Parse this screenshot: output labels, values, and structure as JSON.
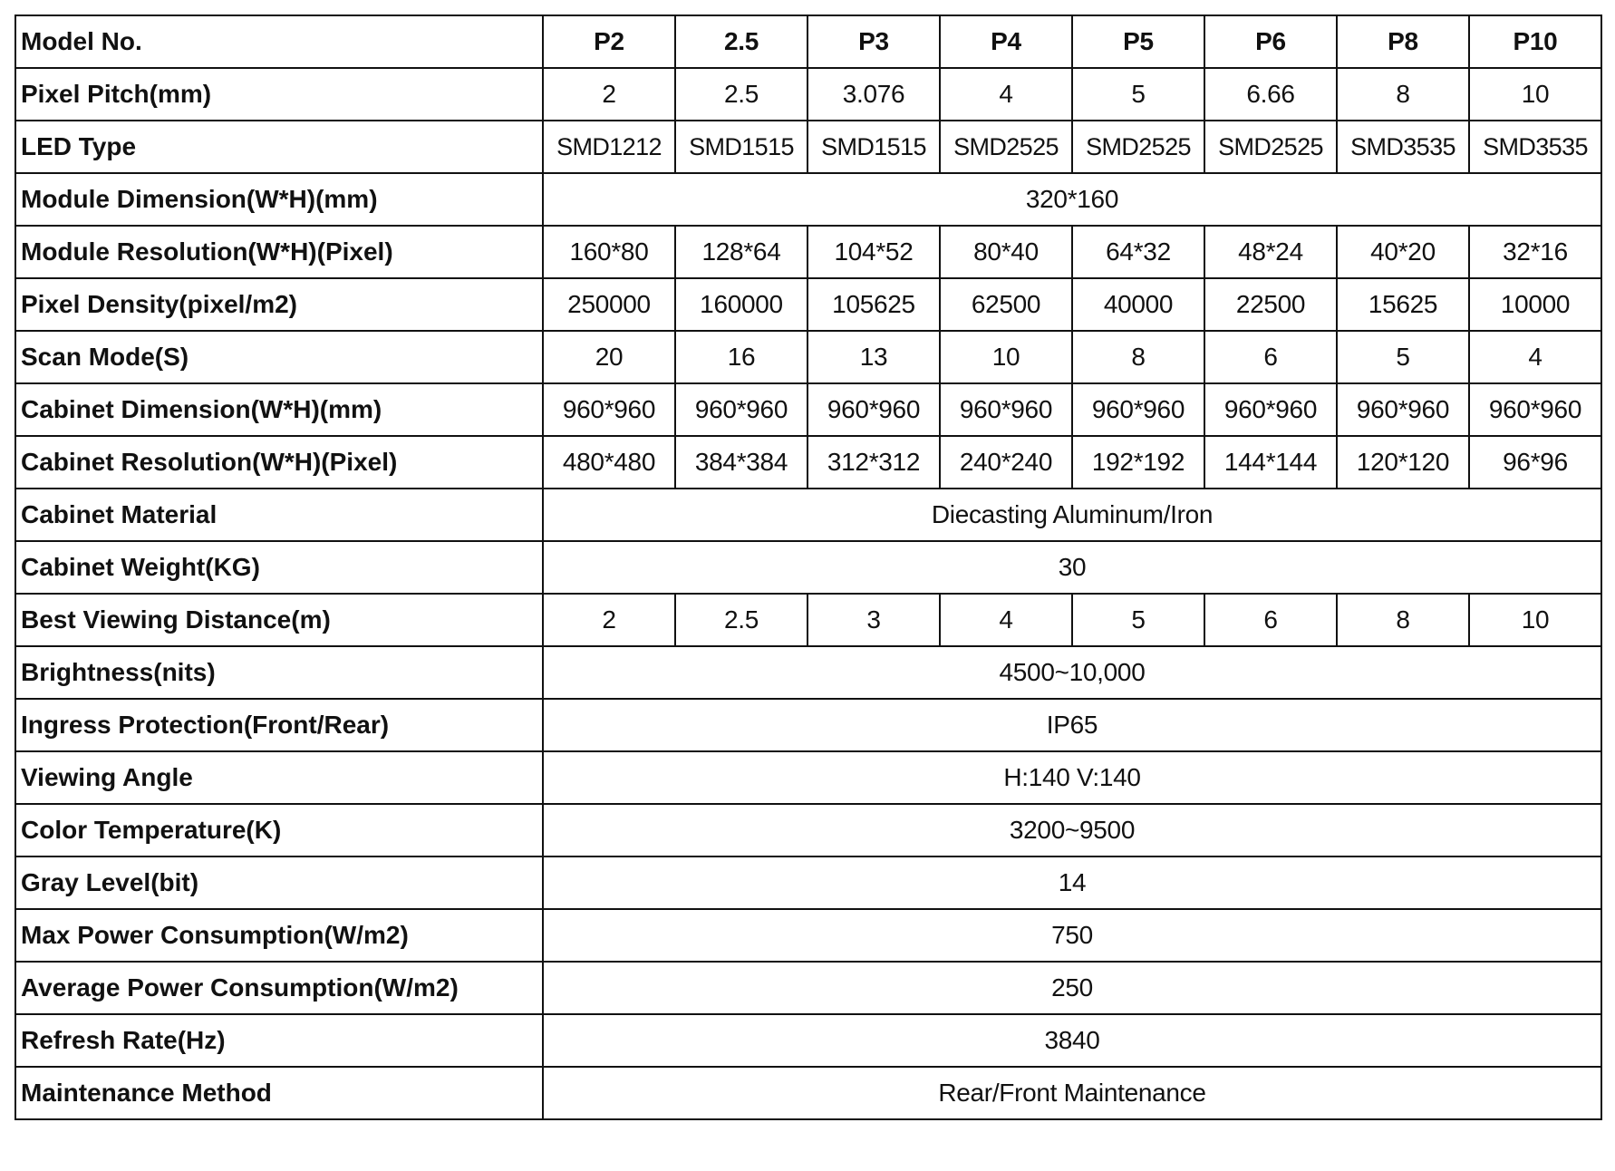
{
  "table": {
    "rows": [
      {
        "label": "Model No.",
        "header": true,
        "values": [
          "P2",
          "2.5",
          "P3",
          "P4",
          "P5",
          "P6",
          "P8",
          "P10"
        ]
      },
      {
        "label": "Pixel Pitch(mm)",
        "values": [
          "2",
          "2.5",
          "3.076",
          "4",
          "5",
          "6.66",
          "8",
          "10"
        ]
      },
      {
        "label": "LED Type",
        "led": true,
        "values": [
          "SMD1212",
          "SMD1515",
          "SMD1515",
          "SMD2525",
          "SMD2525",
          "SMD2525",
          "SMD3535",
          "SMD3535"
        ]
      },
      {
        "label": "Module Dimension(W*H)(mm)",
        "merged": "320*160"
      },
      {
        "label": "Module Resolution(W*H)(Pixel)",
        "values": [
          "160*80",
          "128*64",
          "104*52",
          "80*40",
          "64*32",
          "48*24",
          "40*20",
          "32*16"
        ]
      },
      {
        "label": "Pixel Density(pixel/m2)",
        "values": [
          "250000",
          "160000",
          "105625",
          "62500",
          "40000",
          "22500",
          "15625",
          "10000"
        ]
      },
      {
        "label": "Scan Mode(S)",
        "values": [
          "20",
          "16",
          "13",
          "10",
          "8",
          "6",
          "5",
          "4"
        ]
      },
      {
        "label": "Cabinet Dimension(W*H)(mm)",
        "values": [
          "960*960",
          "960*960",
          "960*960",
          "960*960",
          "960*960",
          "960*960",
          "960*960",
          "960*960"
        ]
      },
      {
        "label": "Cabinet Resolution(W*H)(Pixel)",
        "values": [
          "480*480",
          "384*384",
          "312*312",
          "240*240",
          "192*192",
          "144*144",
          "120*120",
          "96*96"
        ]
      },
      {
        "label": "Cabinet Material",
        "merged": "Diecasting Aluminum/Iron"
      },
      {
        "label": "Cabinet Weight(KG)",
        "merged": "30"
      },
      {
        "label": "Best Viewing Distance(m)",
        "values": [
          "2",
          "2.5",
          "3",
          "4",
          "5",
          "6",
          "8",
          "10"
        ]
      },
      {
        "label": "Brightness(nits)",
        "merged": "4500~10,000"
      },
      {
        "label": "Ingress Protection(Front/Rear)",
        "merged": "IP65"
      },
      {
        "label": "Viewing Angle",
        "merged": "H:140 V:140"
      },
      {
        "label": "Color Temperature(K)",
        "merged": "3200~9500"
      },
      {
        "label": "Gray Level(bit)",
        "merged": "14"
      },
      {
        "label": "Max Power Consumption(W/m2)",
        "merged": "750"
      },
      {
        "label": "Average Power Consumption(W/m2)",
        "merged": "250"
      },
      {
        "label": "Refresh Rate(Hz)",
        "merged": "3840"
      },
      {
        "label": "Maintenance Method",
        "merged": "Rear/Front Maintenance"
      }
    ]
  }
}
